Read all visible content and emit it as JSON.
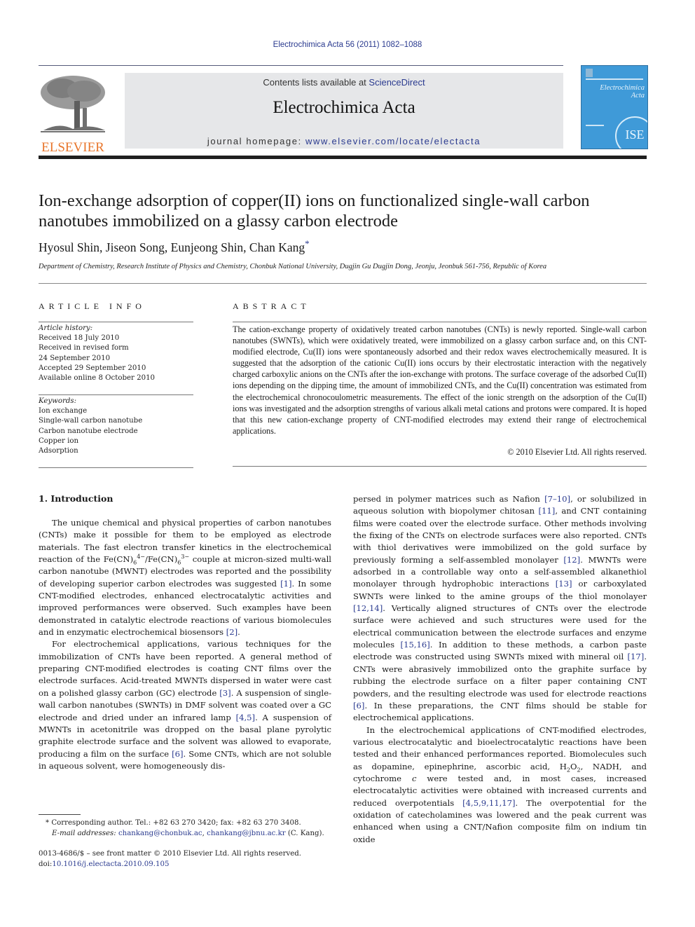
{
  "running_header": "Electrochimica Acta 56 (2011) 1082–1088",
  "masthead": {
    "contents_prefix": "Contents lists available at ",
    "contents_link": "ScienceDirect",
    "journal_title": "Electrochimica Acta",
    "homepage_prefix": "journal homepage: ",
    "homepage_link": "www.elsevier.com/locate/electacta",
    "publisher_logo_text": "ELSEVIER",
    "cover_title_line1": "Electrochimica",
    "cover_title_line2": "Acta",
    "cover_badge": "ISE",
    "colors": {
      "link": "#2a3a8f",
      "elsevier_orange": "#e8762c",
      "cover_blue": "#3f9ad8",
      "masthead_gray": "#e6e7e9"
    }
  },
  "article": {
    "title": "Ion-exchange adsorption of copper(II) ions on functionalized single-wall carbon nanotubes immobilized on a glassy carbon electrode",
    "authors": "Hyosul Shin, Jiseon Song, Eunjeong Shin, Chan Kang",
    "corresponding_mark": "*",
    "affiliation": "Department of Chemistry, Research Institute of Physics and Chemistry, Chonbuk National University, Dugjin Gu Dugjin Dong, Jeonju, Jeonbuk 561-756, Republic of Korea"
  },
  "article_info": {
    "heading": "ARTICLE INFO",
    "history_label": "Article history:",
    "history": [
      "Received 18 July 2010",
      "Received in revised form",
      "24 September 2010",
      "Accepted 29 September 2010",
      "Available online 8 October 2010"
    ],
    "keywords_label": "Keywords:",
    "keywords": [
      "Ion exchange",
      "Single-wall carbon nanotube",
      "Carbon nanotube electrode",
      "Copper ion",
      "Adsorption"
    ]
  },
  "abstract": {
    "heading": "ABSTRACT",
    "text": "The cation-exchange property of oxidatively treated carbon nanotubes (CNTs) is newly reported. Single-wall carbon nanotubes (SWNTs), which were oxidatively treated, were immobilized on a glassy carbon surface and, on this CNT-modified electrode, Cu(II) ions were spontaneously adsorbed and their redox waves electrochemically measured. It is suggested that the adsorption of the cationic Cu(II) ions occurs by their electrostatic interaction with the negatively charged carboxylic anions on the CNTs after the ion-exchange with protons. The surface coverage of the adsorbed Cu(II) ions depending on the dipping time, the amount of immobilized CNTs, and the Cu(II) concentration was estimated from the electrochemical chronocoulometric measurements. The effect of the ionic strength on the adsorption of the Cu(II) ions was investigated and the adsorption strengths of various alkali metal cations and protons were compared. It is hoped that this new cation-exchange property of CNT-modified electrodes may extend their range of electrochemical applications.",
    "copyright": "© 2010 Elsevier Ltd. All rights reserved."
  },
  "body": {
    "section_heading": "1.  Introduction",
    "left": {
      "p1_a": "The unique chemical and physical properties of carbon nanotubes (CNTs) make it possible for them to be employed as electrode materials. The fast electron transfer kinetics in the electrochemical reaction of the Fe(CN)",
      "p1_sub1": "6",
      "p1_sup1": "4−",
      "p1_b": "/Fe(CN)",
      "p1_sub2": "6",
      "p1_sup2": "3−",
      "p1_c": " couple at micron-sized multi-wall carbon nanotube (MWNT) electrodes was reported and the possibility of developing superior carbon electrodes was suggested ",
      "ref1": "[1]",
      "p1_d": ". In some CNT-modified electrodes, enhanced electrocatalytic activities and improved performances were observed. Such examples have been demonstrated in catalytic electrode reactions of various biomolecules and in enzymatic electrochemical biosensors ",
      "ref2": "[2]",
      "p1_e": ".",
      "p2_a": "For electrochemical applications, various techniques for the immobilization of CNTs have been reported. A general method of preparing CNT-modified electrodes is coating CNT films over the electrode surfaces. Acid-treated MWNTs dispersed in water were cast on a polished glassy carbon (GC) electrode ",
      "ref3": "[3]",
      "p2_b": ". A suspension of single-wall carbon nanotubes (SWNTs) in DMF solvent was coated over a GC electrode and dried under an infrared lamp ",
      "ref4": "[4,5]",
      "p2_c": ". A suspension of MWNTs in acetonitrile was dropped on the basal plane pyrolytic graphite electrode surface and the solvent was allowed to evaporate, producing a film on the surface ",
      "ref5": "[6]",
      "p2_d": ". Some CNTs, which are not soluble in aqueous solvent, were homogeneously dis-"
    },
    "right": {
      "p1_a": "persed in polymer matrices such as Nafion ",
      "ref_a": "[7–10]",
      "p1_b": ", or solubilized in aqueous solution with biopolymer chitosan ",
      "ref_b": "[11]",
      "p1_c": ", and CNT containing films were coated over the electrode surface. Other methods involving the fixing of the CNTs on electrode surfaces were also reported. CNTs with thiol derivatives were immobilized on the gold surface by previously forming a self-assembled monolayer ",
      "ref_c": "[12]",
      "p1_d": ". MWNTs were adsorbed in a controllable way onto a self-assembled alkanethiol monolayer through hydrophobic interactions ",
      "ref_d": "[13]",
      "p1_e": " or carboxylated SWNTs were linked to the amine groups of the thiol monolayer ",
      "ref_e": "[12,14]",
      "p1_f": ". Vertically aligned structures of CNTs over the electrode surface were achieved and such structures were used for the electrical communication between the electrode surfaces and enzyme molecules ",
      "ref_f": "[15,16]",
      "p1_g": ". In addition to these methods, a carbon paste electrode was constructed using SWNTs mixed with mineral oil ",
      "ref_g": "[17]",
      "p1_h": ". CNTs were abrasively immobilized onto the graphite surface by rubbing the electrode surface on a filter paper containing CNT powders, and the resulting electrode was used for electrode reactions ",
      "ref_h": "[6]",
      "p1_i": ". In these preparations, the CNT films should be stable for electrochemical applications.",
      "p2_a": "In the electrochemical applications of CNT-modified electrodes, various electrocatalytic and bioelectrocatalytic reactions have been tested and their enhanced performances reported. Biomolecules such as dopamine, epinephrine, ascorbic acid, H",
      "p2_sub1": "2",
      "p2_b": "O",
      "p2_sub2": "2",
      "p2_c": ", NADH, and cytochrome ",
      "p2_italic": "c",
      "p2_d": " were tested and, in most cases, increased electrocatalytic activities were obtained with increased currents and reduced overpotentials ",
      "ref_i": "[4,5,9,11,17]",
      "p2_e": ". The overpotential for the oxidation of catecholamines was lowered and the peak current was enhanced when using a CNT/Nafion composite film on indium tin oxide"
    }
  },
  "footnote": {
    "star": "*",
    "corresponding": " Corresponding author. Tel.: +82 63 270 3420; fax: +82 63 270 3408.",
    "email_label": "E-mail addresses:",
    "email1": "chankang@chonbuk.ac",
    "email_sep": ", ",
    "email2": "chankang@jbnu.ac.kr",
    "email_suffix": " (C. Kang)."
  },
  "issn": {
    "line1": "0013-4686/$ – see front matter © 2010 Elsevier Ltd. All rights reserved.",
    "doi_prefix": "doi:",
    "doi": "10.1016/j.electacta.2010.09.105"
  }
}
